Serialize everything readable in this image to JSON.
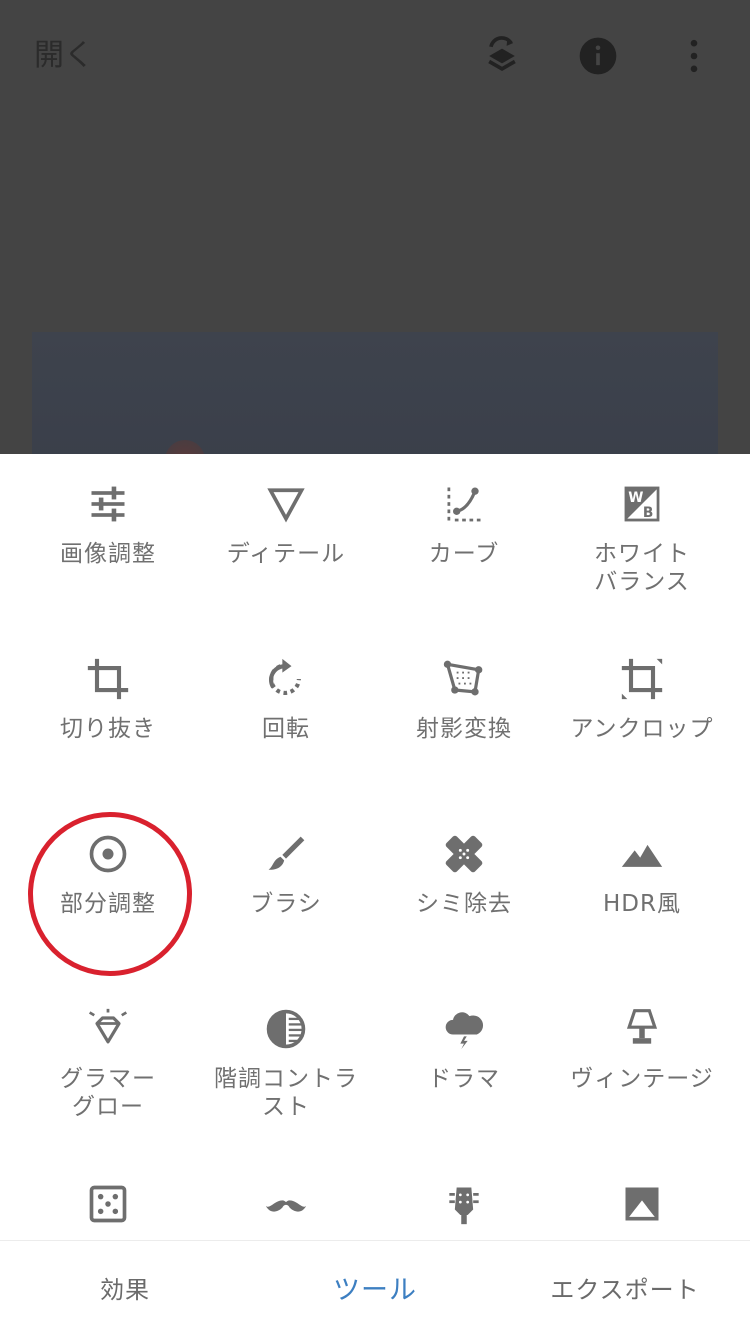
{
  "header": {
    "open_label": "開く",
    "icons": [
      "layers-revert-icon",
      "info-icon",
      "more-vert-icon"
    ]
  },
  "tools": [
    {
      "label": "画像調整",
      "icon": "tune-sliders-icon"
    },
    {
      "label": "ディテール",
      "icon": "triangle-down-icon"
    },
    {
      "label": "カーブ",
      "icon": "curve-icon"
    },
    {
      "label": "ホワイト\nバランス",
      "icon": "white-balance-icon"
    },
    {
      "label": "切り抜き",
      "icon": "crop-icon"
    },
    {
      "label": "回転",
      "icon": "rotate-icon"
    },
    {
      "label": "射影変換",
      "icon": "perspective-icon"
    },
    {
      "label": "アンクロップ",
      "icon": "uncrop-icon"
    },
    {
      "label": "部分調整",
      "icon": "selective-target-icon"
    },
    {
      "label": "ブラシ",
      "icon": "brush-icon"
    },
    {
      "label": "シミ除去",
      "icon": "healing-bandage-icon"
    },
    {
      "label": "HDR風",
      "icon": "mountains-icon"
    },
    {
      "label": "グラマー\nグロー",
      "icon": "diamond-glow-icon"
    },
    {
      "label": "階調コントラ\nスト",
      "icon": "tonal-contrast-icon"
    },
    {
      "label": "ドラマ",
      "icon": "storm-cloud-icon"
    },
    {
      "label": "ヴィンテージ",
      "icon": "lamp-icon"
    },
    {
      "label": "",
      "icon": "grainy-film-icon"
    },
    {
      "label": "",
      "icon": "mustache-icon"
    },
    {
      "label": "",
      "icon": "guitar-head-icon"
    },
    {
      "label": "",
      "icon": "black-white-icon"
    }
  ],
  "highlighted_tool": "部分調整",
  "bottom_nav": {
    "tabs": [
      "効果",
      "ツール",
      "エクスポート"
    ],
    "active": "ツール"
  },
  "colors": {
    "top_bg": "#444444",
    "icon_gray": "#707070",
    "accent_blue": "#3d7fc1",
    "highlight_red": "#d9212e"
  }
}
